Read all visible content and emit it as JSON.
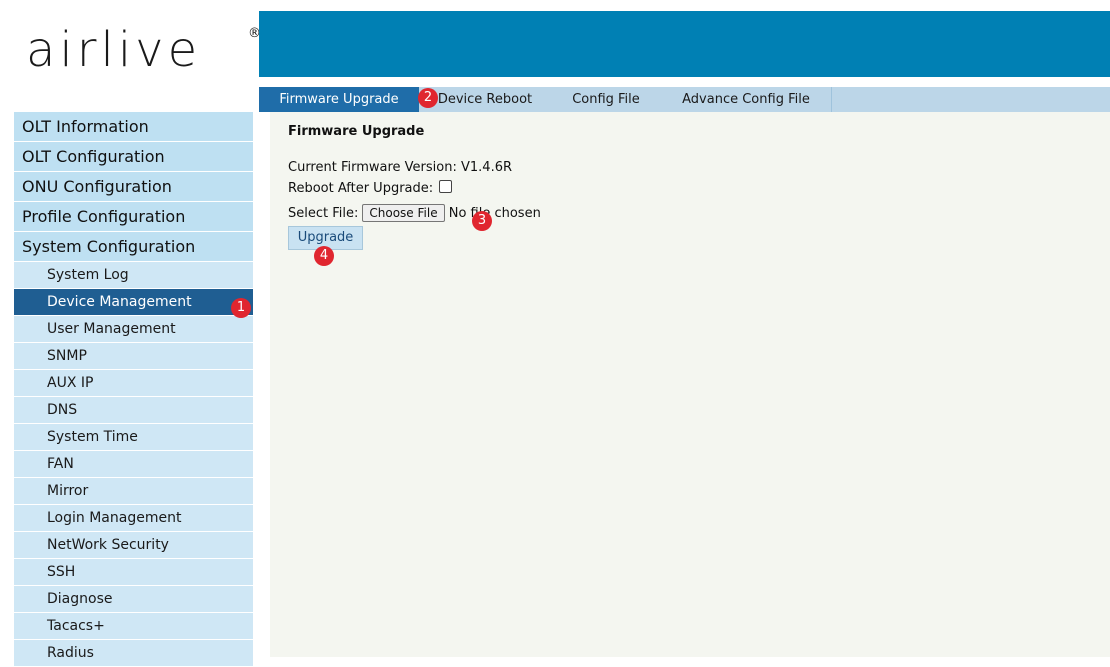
{
  "logo": {
    "text": "airlive",
    "reg": "®"
  },
  "tabs": [
    "Firmware Upgrade",
    "Device Reboot",
    "Config File",
    "Advance Config File"
  ],
  "sidebar": {
    "menu": [
      "OLT Information",
      "OLT Configuration",
      "ONU Configuration",
      "Profile Configuration",
      "System Configuration"
    ],
    "sub": [
      "System Log",
      "Device Management",
      "User Management",
      "SNMP",
      "AUX IP",
      "DNS",
      "System Time",
      "FAN",
      "Mirror",
      "Login Management",
      "NetWork Security",
      "SSH",
      "Diagnose",
      "Tacacs+",
      "Radius"
    ]
  },
  "content": {
    "title": "Firmware Upgrade",
    "version_label": "Current Firmware Version:",
    "version_value": "V1.4.6R",
    "reboot_label": "Reboot After Upgrade:",
    "file_label": "Select File:",
    "choose_button": "Choose File",
    "file_status": "No file chosen",
    "upgrade_button": "Upgrade"
  },
  "markers": [
    "1",
    "2",
    "3",
    "4"
  ]
}
